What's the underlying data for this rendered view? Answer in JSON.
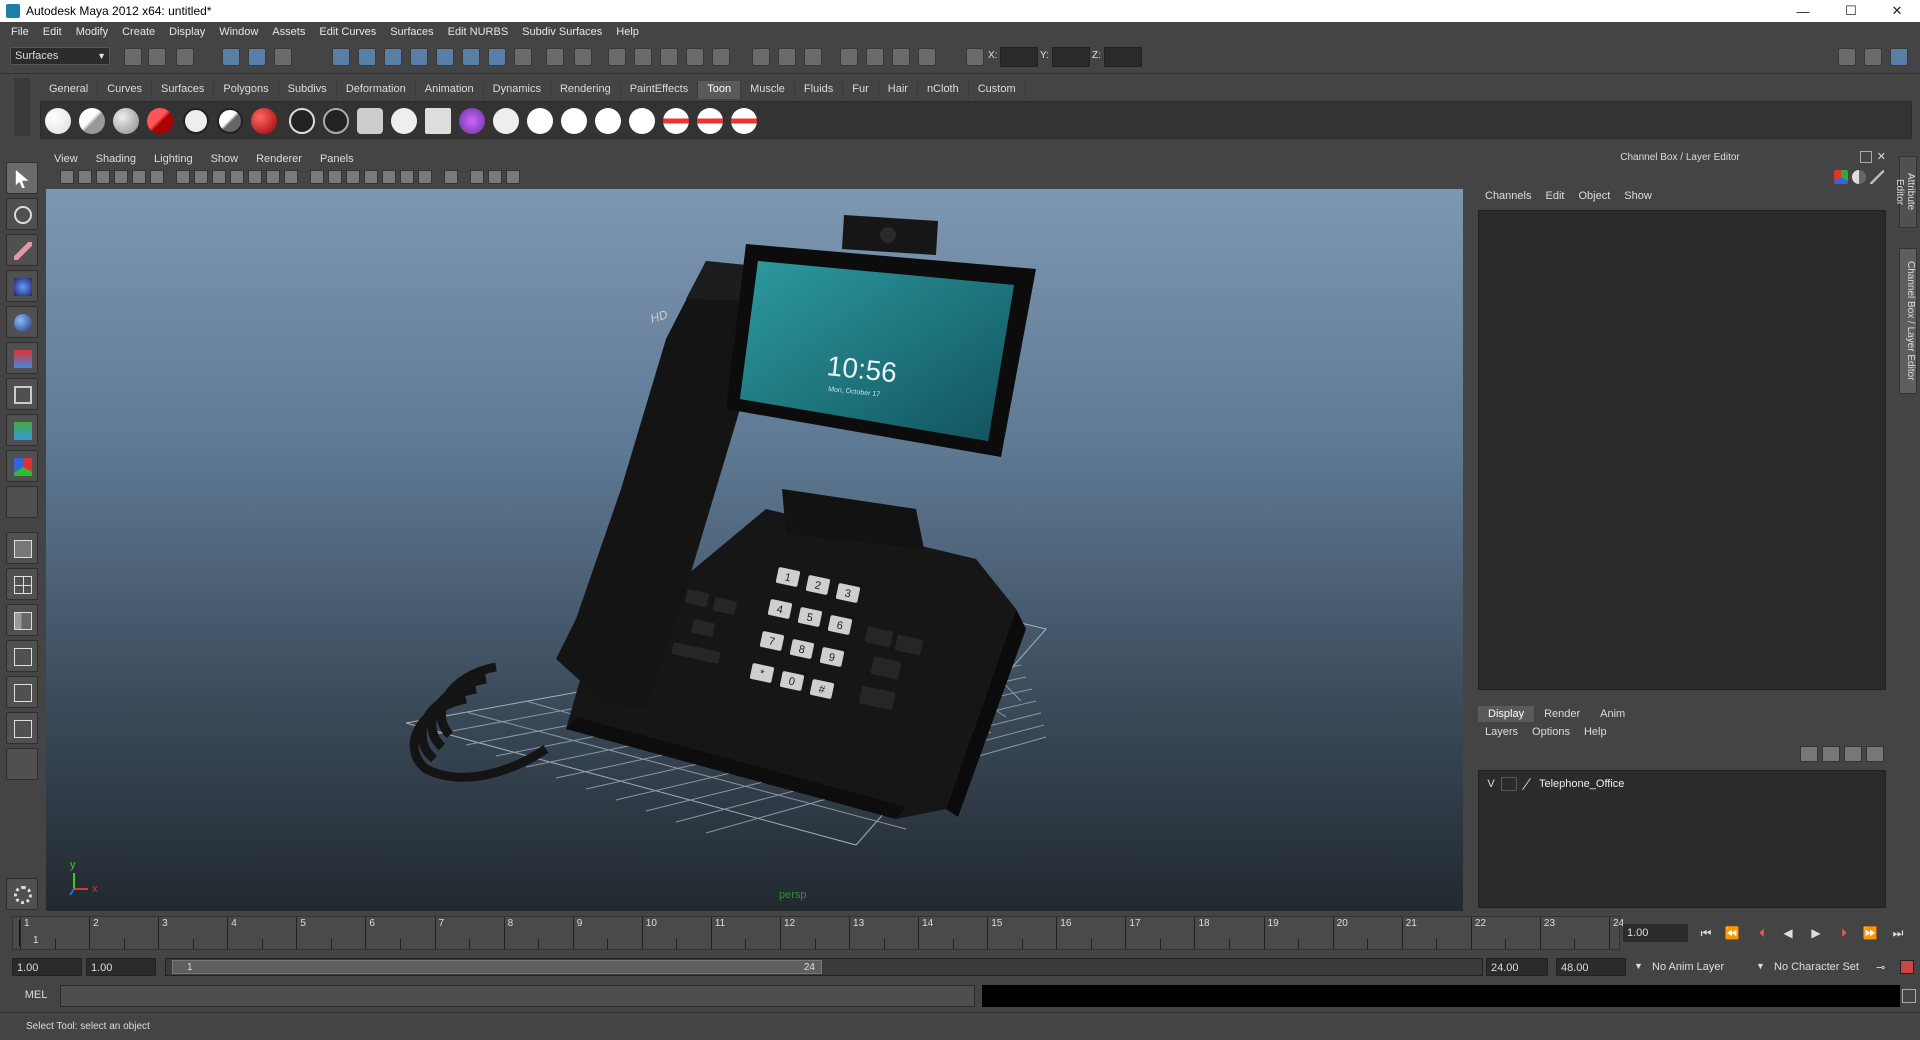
{
  "window": {
    "title": "Autodesk Maya 2012 x64: untitled*",
    "minimize_glyph": "—",
    "maximize_glyph": "☐",
    "close_glyph": "✕"
  },
  "menubar": [
    "File",
    "Edit",
    "Modify",
    "Create",
    "Display",
    "Window",
    "Assets",
    "Edit Curves",
    "Surfaces",
    "Edit NURBS",
    "Subdiv Surfaces",
    "Help"
  ],
  "status_line": {
    "mode": "Surfaces",
    "x_label": "X:",
    "y_label": "Y:",
    "z_label": "Z:"
  },
  "shelf": {
    "tabs": [
      "General",
      "Curves",
      "Surfaces",
      "Polygons",
      "Subdivs",
      "Deformation",
      "Animation",
      "Dynamics",
      "Rendering",
      "PaintEffects",
      "Toon",
      "Muscle",
      "Fluids",
      "Fur",
      "Hair",
      "nCloth",
      "Custom"
    ],
    "active": "Toon"
  },
  "viewport": {
    "menu": [
      "View",
      "Shading",
      "Lighting",
      "Show",
      "Renderer",
      "Panels"
    ],
    "camera": "persp",
    "axis_y": "y",
    "axis_x": "x",
    "phone": {
      "brand": "HD",
      "time": "10:56",
      "date": "Mon, October 17",
      "keys": [
        "1",
        "2",
        "3",
        "4",
        "5",
        "6",
        "7",
        "8",
        "9",
        "*",
        "0",
        "#"
      ]
    }
  },
  "channel_box": {
    "title": "Channel Box / Layer Editor",
    "menu": [
      "Channels",
      "Edit",
      "Object",
      "Show"
    ]
  },
  "layer_editor": {
    "tabs": [
      "Display",
      "Render",
      "Anim"
    ],
    "active": "Display",
    "menu": [
      "Layers",
      "Options",
      "Help"
    ],
    "layers": [
      {
        "visible": "V",
        "name": "Telephone_Office"
      }
    ]
  },
  "side_tabs": [
    "Attribute Editor",
    "Channel Box / Layer Editor"
  ],
  "timeline": {
    "frames": [
      "1",
      "2",
      "3",
      "4",
      "5",
      "6",
      "7",
      "8",
      "9",
      "10",
      "11",
      "12",
      "13",
      "14",
      "15",
      "16",
      "17",
      "18",
      "19",
      "20",
      "21",
      "22",
      "23",
      "24"
    ],
    "current_frame": "1.00",
    "current_marker": "1"
  },
  "range": {
    "start": "1.00",
    "start_inner": "1.00",
    "slider_start": "1",
    "slider_end": "24",
    "end_inner": "24.00",
    "end": "48.00",
    "anim_layer": "No Anim Layer",
    "character_set": "No Character Set"
  },
  "command_line": {
    "label": "MEL"
  },
  "help_line": "Select Tool: select an object",
  "colors": {
    "ui_bg": "#444444",
    "field_bg": "#2b2b2b",
    "active_tab": "#5a5a5a",
    "camera_label": "#2d8f3a"
  }
}
